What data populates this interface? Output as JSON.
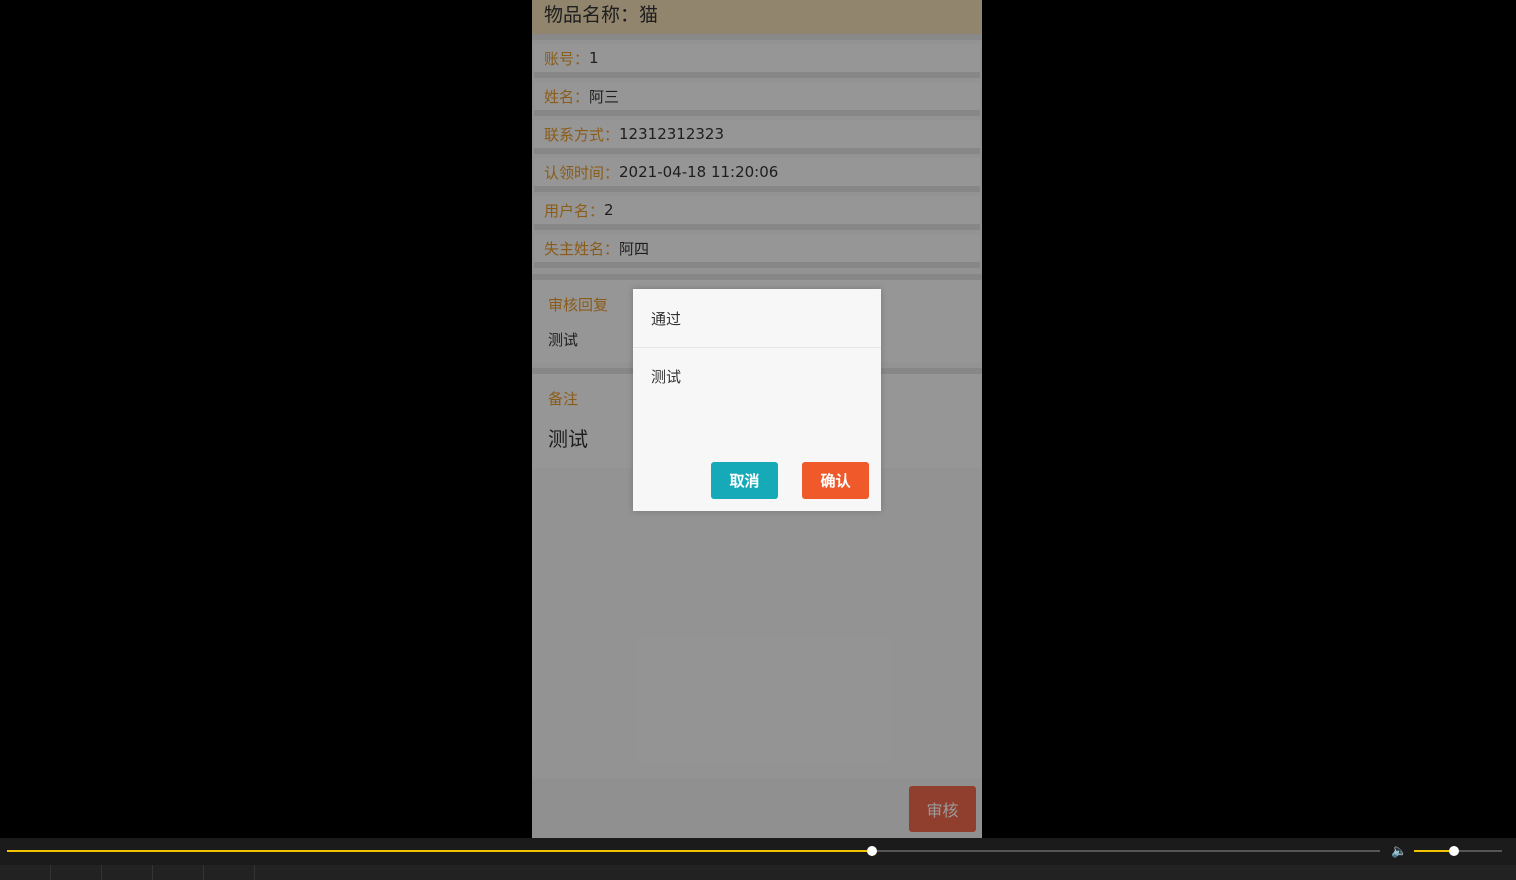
{
  "header": {
    "title": "物品名称：猫"
  },
  "fields": [
    {
      "label": "账号：",
      "value": "1"
    },
    {
      "label": "姓名：",
      "value": "阿三"
    },
    {
      "label": "联系方式：",
      "value": "12312312323"
    },
    {
      "label": "认领时间：",
      "value": "2021-04-18 11:20:06"
    },
    {
      "label": "用户名：",
      "value": "2"
    },
    {
      "label": "失主姓名：",
      "value": "阿四"
    }
  ],
  "review_reply": {
    "title": "审核回复",
    "text": "测试"
  },
  "remark": {
    "title": "备注",
    "text": "测试"
  },
  "bottom_bar": {
    "audit_label": "审核"
  },
  "dialog": {
    "title": "通过",
    "body": "测试",
    "cancel_label": "取消",
    "confirm_label": "确认"
  },
  "player": {
    "seek_progress": 0.63,
    "volume_level": 0.45,
    "volume_icon": "speaker-icon"
  },
  "colors": {
    "header_bg": "#f3deb6",
    "label": "#e89a2b",
    "cancel": "#16aab8",
    "confirm": "#f05a2a",
    "audit": "#f06a4e",
    "progress": "#f2c200"
  }
}
